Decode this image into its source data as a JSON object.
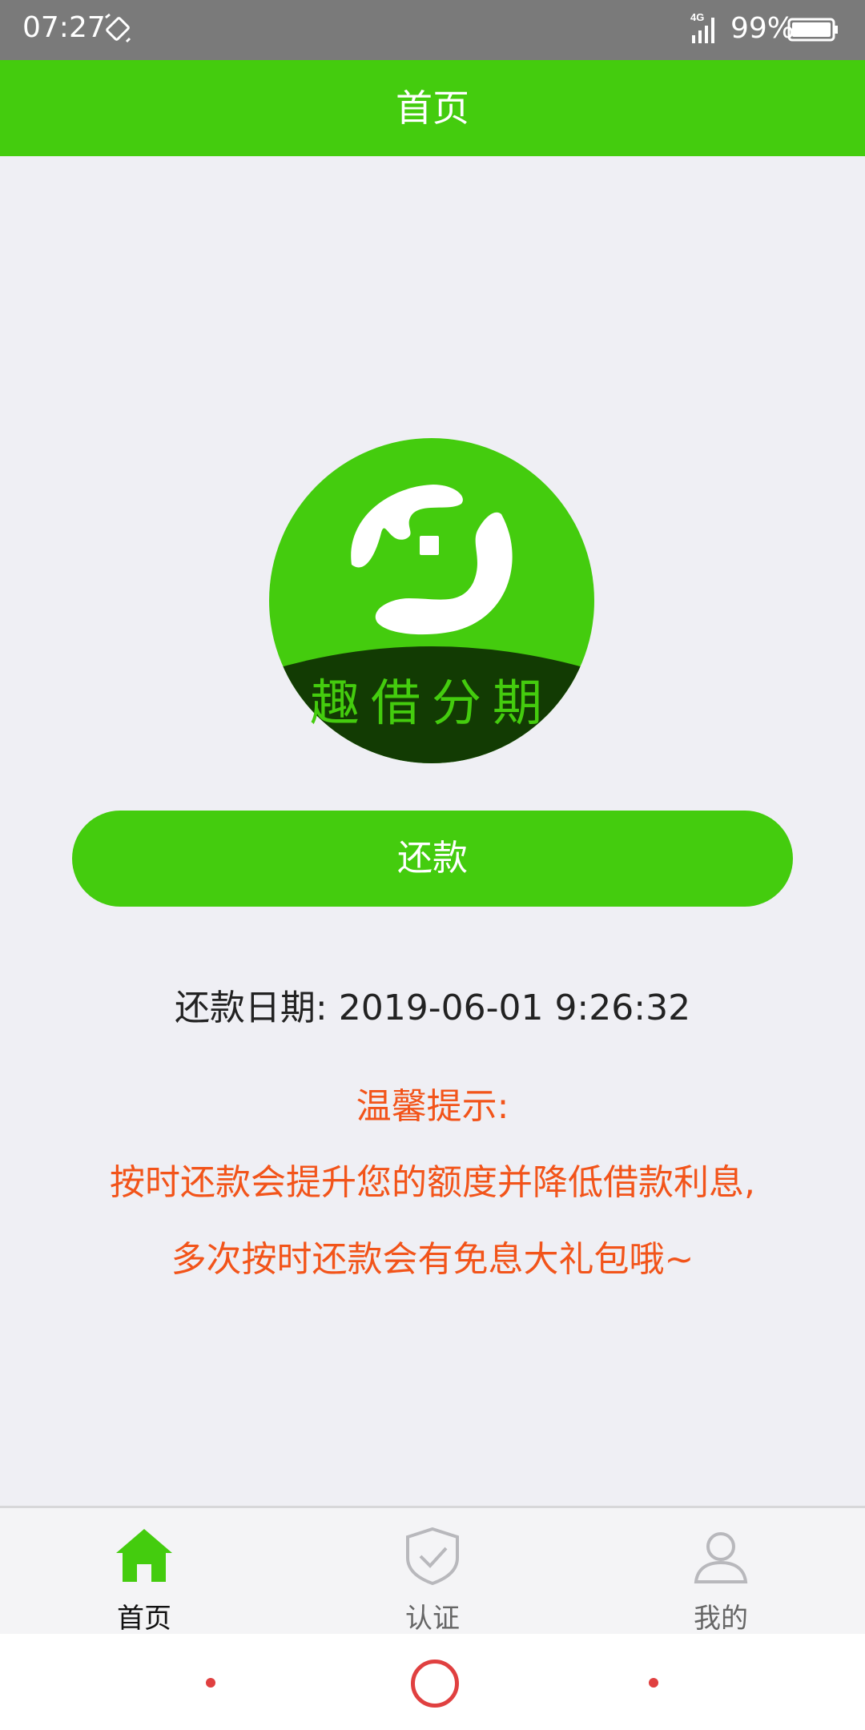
{
  "status_bar": {
    "time": "07:27",
    "network": "4G",
    "battery": "99%"
  },
  "app_bar": {
    "title": "首页"
  },
  "logo": {
    "icon": "qu-jie-fenqi-logo",
    "text": "趣借分期",
    "colors": {
      "light": "#44cc0e",
      "dark": "#123b03"
    }
  },
  "repay_button": {
    "label": "还款"
  },
  "due_date": {
    "text": "还款日期: 2019-06-01 9:26:32"
  },
  "tip": {
    "title": "温馨提示:",
    "line1": "按时还款会提升您的额度并降低借款利息,",
    "line2": "多次按时还款会有免息大礼包哦~"
  },
  "tabs": [
    {
      "label": "首页",
      "icon": "home-icon",
      "active": true
    },
    {
      "label": "认证",
      "icon": "shield-check-icon",
      "active": false
    },
    {
      "label": "我的",
      "icon": "user-icon",
      "active": false
    }
  ],
  "colors": {
    "brand": "#44cc0e",
    "tip": "#f2541a",
    "background": "#efeff4",
    "status_bar": "#7a7a7a"
  }
}
